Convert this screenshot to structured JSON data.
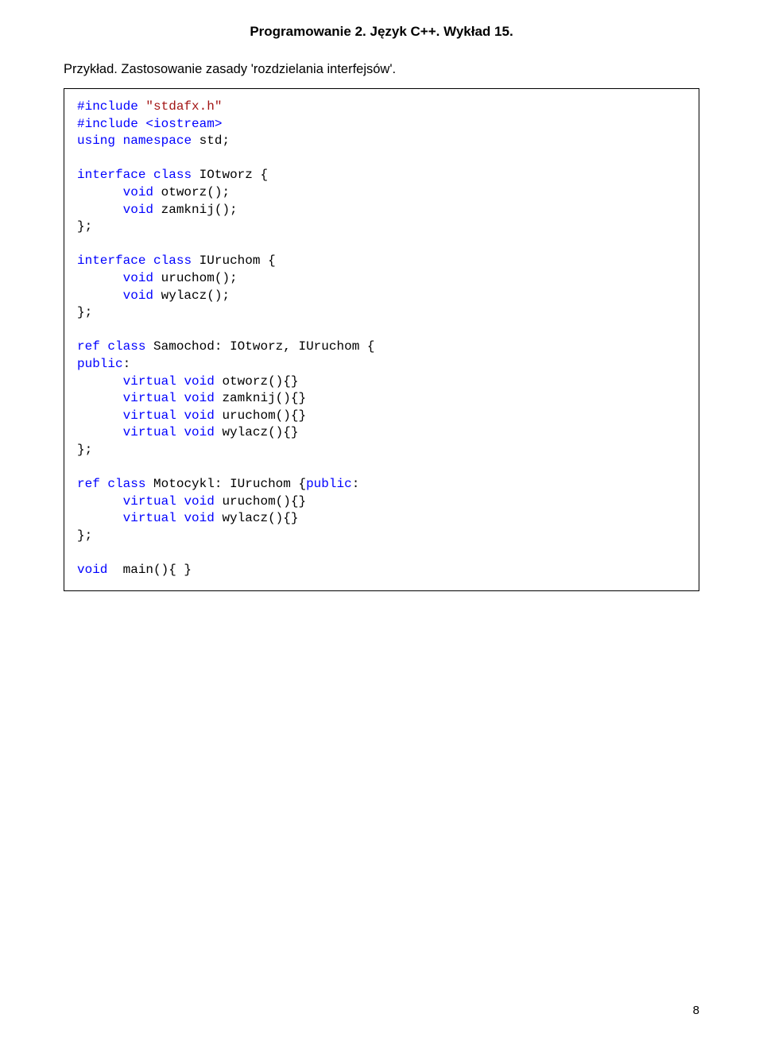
{
  "header": {
    "title": "Programowanie 2. Język C++. Wykład 15."
  },
  "subtitle": "Przykład. Zastosowanie zasady 'rozdzielania interfejsów'.",
  "page_number": "8",
  "code": {
    "include_directive": "#include",
    "stdafx": "\"stdafx.h\"",
    "iostream": "<iostream>",
    "using_kw": "using",
    "namespace_kw": "namespace",
    "std": "std;",
    "interface_kw": "interface",
    "class_kw": "class",
    "iotworz_name": "IOtworz {",
    "void_kw": "void",
    "otworz_decl": "otworz();",
    "zamknij_decl": "zamknij();",
    "close_brace": "};",
    "iuruchom_name": "IUruchom {",
    "uruchom_decl": "uruchom();",
    "wylacz_decl": "wylacz();",
    "ref_kw": "ref",
    "samochod_decl": "Samochod: IOtworz, IUruchom {",
    "public_kw": "public",
    "colon": ":",
    "virtual_kw": "virtual",
    "otworz_body": "otworz(){}",
    "zamknij_body": "zamknij(){}",
    "uruchom_body": "uruchom(){}",
    "wylacz_body": "wylacz(){}",
    "motocykl_decl_part1": "Motocykl: IUruchom {",
    "main_decl": "main(){ }"
  }
}
